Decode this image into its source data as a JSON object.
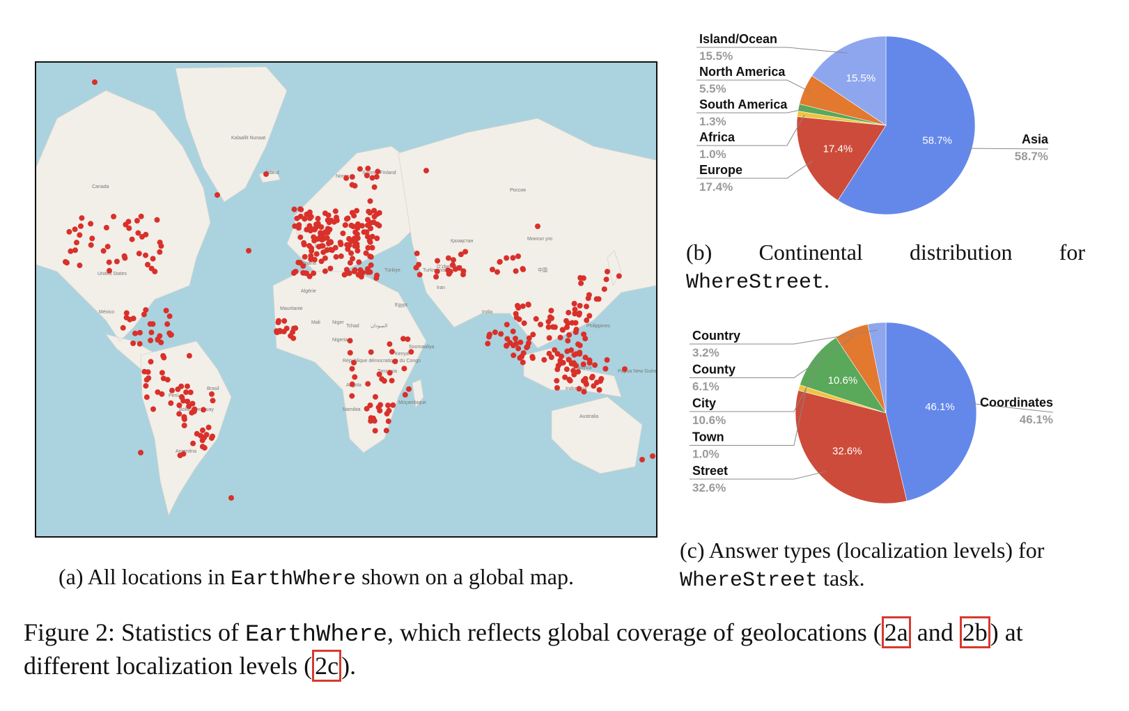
{
  "map": {
    "caption": "(a) All locations in EarthWhere shown on a global map.",
    "caption_parts": {
      "prefix": "(a) All locations in ",
      "code": "EarthWhere",
      "suffix": " shown on a global map."
    },
    "marker_color": "#d9302a",
    "labels": [
      "Kalaallit Nunaat",
      "Ísland",
      "Canada",
      "United States",
      "México",
      "Norge",
      "Suomi / Finland",
      "Россия",
      "Қазақстан",
      "Монгол улс",
      "中国",
      "India",
      "Brasil",
      "Perú",
      "Bolivia",
      "Paraguay",
      "Argentina",
      "Algérie",
      "Mali",
      "Niger",
      "Tchad",
      "السودان",
      "Nigeria",
      "République démocratique du Congo",
      "Tanzania",
      "Angola",
      "Namibia",
      "Moçambique",
      "Australia",
      "Papua New Guinea",
      "Philippines",
      "Malaysia",
      "Indonesia",
      "Türkiye",
      "Iran",
      "France",
      "España",
      "Mauritanie",
      "Egypt",
      "Soomaaliya",
      "Kenya",
      "Turkmenistan",
      "Oʻzbekiston"
    ]
  },
  "chart_data": [
    {
      "type": "pie",
      "caption_parts": {
        "line1": [
          "(b)",
          "Continental",
          "distribution",
          "for"
        ],
        "code": "WhereStreet",
        "suffix": "."
      },
      "slices": [
        {
          "label": "Asia",
          "value": 58.7,
          "pct": "58.7%",
          "color": "#6488ea"
        },
        {
          "label": "Europe",
          "value": 17.4,
          "pct": "17.4%",
          "color": "#cd4b3a"
        },
        {
          "label": "Africa",
          "value": 1.0,
          "pct": "1.0%",
          "color": "#efc53f"
        },
        {
          "label": "South America",
          "value": 1.3,
          "pct": "1.3%",
          "color": "#5aa85a"
        },
        {
          "label": "North America",
          "value": 5.5,
          "pct": "5.5%",
          "color": "#e3782f"
        },
        {
          "label": "Island/Ocean",
          "value": 15.5,
          "pct": "15.5%",
          "color": "#8da6ee"
        }
      ]
    },
    {
      "type": "pie",
      "caption_parts": {
        "line1": "(c) Answer types (localization levels) for",
        "code": "WhereStreet",
        "suffix": " task."
      },
      "slices": [
        {
          "label": "Coordinates",
          "value": 46.1,
          "pct": "46.1%",
          "color": "#6488ea"
        },
        {
          "label": "Street",
          "value": 32.6,
          "pct": "32.6%",
          "color": "#cd4b3a"
        },
        {
          "label": "Town",
          "value": 1.0,
          "pct": "1.0%",
          "color": "#efc53f"
        },
        {
          "label": "City",
          "value": 10.6,
          "pct": "10.6%",
          "color": "#5aa85a"
        },
        {
          "label": "County",
          "value": 6.1,
          "pct": "6.1%",
          "color": "#e3782f"
        },
        {
          "label": "Country",
          "value": 3.2,
          "pct": "3.2%",
          "color": "#8da6ee"
        }
      ]
    }
  ],
  "figure_caption": {
    "prefix": "Figure 2: Statistics of ",
    "code": "EarthWhere",
    "mid": ", which reflects global coverage of geolocations (",
    "ref_a": "2a",
    "and": " and ",
    "ref_b": "2b",
    "mid2": ") at different localization levels (",
    "ref_c": "2c",
    "end": ")."
  }
}
